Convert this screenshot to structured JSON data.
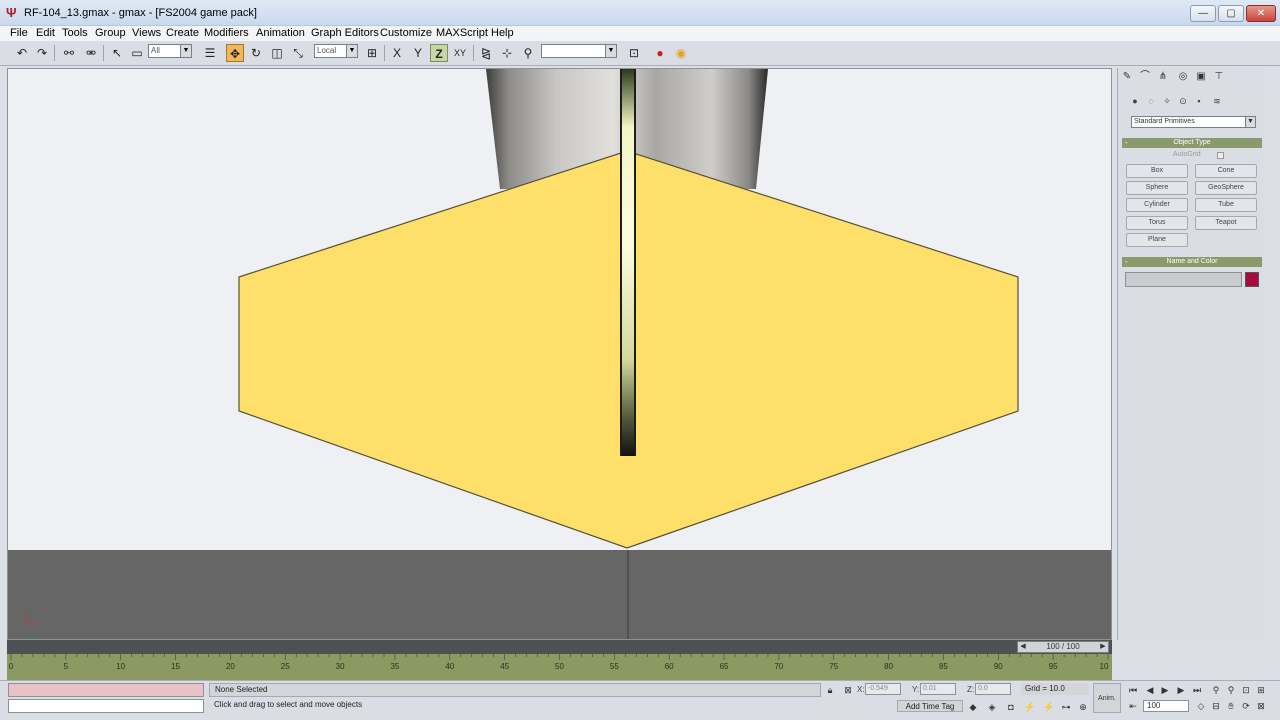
{
  "window": {
    "title": "RF-104_13.gmax - gmax - [FS2004 game pack]",
    "minimize_glyph": "—",
    "maximize_glyph": "▢",
    "close_glyph": "✕"
  },
  "menu": [
    "File",
    "Edit",
    "Tools",
    "Group",
    "Views",
    "Create",
    "Modifiers",
    "Animation",
    "Graph Editors",
    "Customize",
    "MAXScript",
    "Help"
  ],
  "toolbar": {
    "selection_filter": "All",
    "reference_coord": "Local",
    "axis_x": "X",
    "axis_y": "Y",
    "axis_z": "Z",
    "axis_xy": "XY",
    "named_selection": ""
  },
  "command_panel": {
    "category": "Standard Primitives",
    "object_type_title": "Object Type",
    "autogrid_label": "AutoGrid",
    "primitives": [
      "Box",
      "Cone",
      "Sphere",
      "GeoSphere",
      "Cylinder",
      "Tube",
      "Torus",
      "Teapot",
      "Plane"
    ],
    "name_color_title": "Name and Color",
    "name_value": "",
    "object_color": "#a80c3e"
  },
  "time": {
    "frame_display": "100 / 100",
    "ruler_ticks": [
      "0",
      "5",
      "10",
      "15",
      "20",
      "25",
      "30",
      "35",
      "40",
      "45",
      "50",
      "55",
      "60",
      "65",
      "70",
      "75",
      "80",
      "85",
      "90",
      "95",
      "10"
    ]
  },
  "status": {
    "selection": "None Selected",
    "prompt": "Click and drag to select and move objects",
    "x_label": "X:",
    "x_value": "-0.549",
    "y_label": "Y:",
    "y_value": "0.01",
    "z_label": "Z:",
    "z_value": "0.0",
    "grid": "Grid = 10.0",
    "add_time_tag": "Add Time Tag",
    "anim_label": "Anim.",
    "current_frame": "100"
  },
  "colors": {
    "model_yellow": "#fddf69",
    "viewport_bg": "#eef0f3",
    "ground": "#666666",
    "track": "#8a9a62",
    "active_tool": "#f0b85a"
  }
}
